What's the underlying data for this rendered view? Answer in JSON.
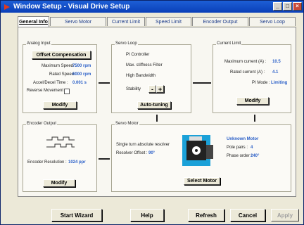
{
  "window": {
    "title": "Window Setup - Visual Drive Setup"
  },
  "tabs": [
    {
      "label": "General Info"
    },
    {
      "label": "Servo Motor"
    },
    {
      "label": "Current Limit"
    },
    {
      "label": "Speed Limit"
    },
    {
      "label": "Encoder Output"
    },
    {
      "label": "Servo Loop"
    }
  ],
  "analog_input": {
    "title": "Analog Input",
    "offset_button": "Offset Compensation",
    "max_speed_label": "Maximum Speed :",
    "max_speed_value": "7500 rpm",
    "rated_speed_label": "Rated Speed :",
    "rated_speed_value": "6000 rpm",
    "accel_label": "Accel/Decel Time :",
    "accel_value": "0.001 s",
    "reverse_label": "Reverse Movement :",
    "modify": "Modify"
  },
  "servo_loop": {
    "title": "Servo Loop",
    "line1": "PI Controller",
    "line2": "Max. stiffness Filter",
    "line3": "High Bandwidth",
    "stability_label": "Stability",
    "minus": "-",
    "plus": "+",
    "autotuning": "Auto-tuning"
  },
  "current_limit": {
    "title": "Current Limit",
    "max_label": "Maximum current (A) :",
    "max_value": "10.5",
    "rated_label": "Rated current (A) :",
    "rated_value": "4.1",
    "pi_label": "PI Mode :",
    "pi_value": "Limiting",
    "modify": "Modify"
  },
  "encoder_output": {
    "title": "Encoder Output",
    "resolution_label": "Encoder Resolution :",
    "resolution_value": "1024 ppr",
    "modify": "Modify"
  },
  "servo_motor": {
    "title": "Servo Motor",
    "resolver_label": "Single turn absolute resolver",
    "offset_label": "Resolver Offset :",
    "offset_value": "90°",
    "motor_name": "Unknown Motor",
    "pole_label": "Pole pairs :",
    "pole_value": "4",
    "phase_label": "Phase order :",
    "phase_value": "240°",
    "select": "Select Motor"
  },
  "footer": {
    "start_wizard": "Start Wizard",
    "help": "Help",
    "refresh": "Refresh",
    "cancel": "Cancel",
    "apply": "Apply"
  },
  "colors": {
    "title_bar": "#0a3fb8",
    "value_text": "#2a5fc8",
    "motor_icon": "#1ba1d8"
  }
}
